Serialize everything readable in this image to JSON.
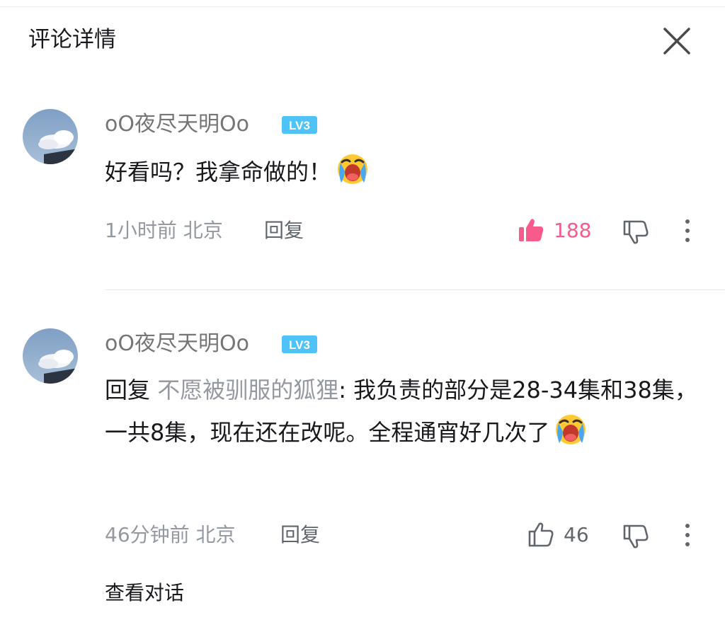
{
  "header": {
    "title": "评论详情",
    "close_icon": "close-icon"
  },
  "comments": [
    {
      "username": "oO夜尽天明Oo",
      "level_badge": "LV3",
      "text": "好看吗？我拿命做的！",
      "emoji": "crying-emoji",
      "time": "1小时前",
      "location": "北京",
      "reply_label": "回复",
      "likes": "188",
      "liked": true,
      "like_color": "#f85a8c"
    },
    {
      "username": "oO夜尽天明Oo",
      "level_badge": "LV3",
      "reply_prefix": "回复",
      "reply_to": "不愿被驯服的狐狸",
      "text": ": 我负责的部分是28-34集和38集，一共8集，现在还在改呢。全程通宵好几次了",
      "emoji": "crying-emoji",
      "time": "46分钟前",
      "location": "北京",
      "reply_label": "回复",
      "likes": "46",
      "liked": false
    }
  ],
  "footer": {
    "view_conversation": "查看对话"
  },
  "colors": {
    "accent_pink": "#f85a8c",
    "badge_blue": "#4fc3f7",
    "secondary_text": "#9499a0"
  }
}
